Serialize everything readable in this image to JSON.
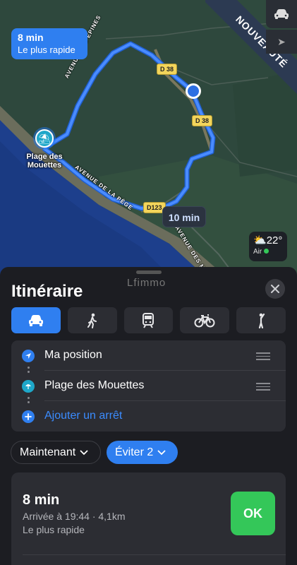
{
  "map": {
    "fast_callout": {
      "time": "8 min",
      "label": "Le plus rapide"
    },
    "alt_callout": {
      "time": "10 min"
    },
    "destination_label": "Plage des Mouettes",
    "street_labels": {
      "avenue_des_epines": "AVENUE DES EPINES",
      "avenue_de_la_pege": "AVENUE DE LA PÈGE",
      "avenue_des_mimosas": "AVENUE DES MIMO"
    },
    "road_shields": {
      "d38_top": "D 38",
      "d38_side": "D 38",
      "d123": "D123"
    },
    "ribbon": "NOUVEAUTÉ",
    "weather": {
      "temp": "22°",
      "air_label": "Air"
    },
    "colors": {
      "route": "#3a86ff",
      "water": "#1d3f8c",
      "land": "#2f4a3e"
    }
  },
  "sheet": {
    "title": "Itinéraire",
    "watermark": "Lfimmo",
    "modes": [
      {
        "name": "car",
        "active": true
      },
      {
        "name": "walk",
        "active": false
      },
      {
        "name": "transit",
        "active": false
      },
      {
        "name": "bike",
        "active": false
      },
      {
        "name": "rideshare",
        "active": false
      }
    ],
    "stops": {
      "origin": "Ma position",
      "destination": "Plage des Mouettes",
      "add_stop": "Ajouter un arrêt"
    },
    "filters": {
      "when": "Maintenant",
      "avoid": "Éviter 2"
    },
    "route": {
      "duration": "8 min",
      "arrival": "Arrivée à 19:44 · 4,1km",
      "kind": "Le plus rapide",
      "ok_label": "OK"
    },
    "colors": {
      "accent": "#2f7ff0",
      "ok": "#34c759"
    }
  }
}
